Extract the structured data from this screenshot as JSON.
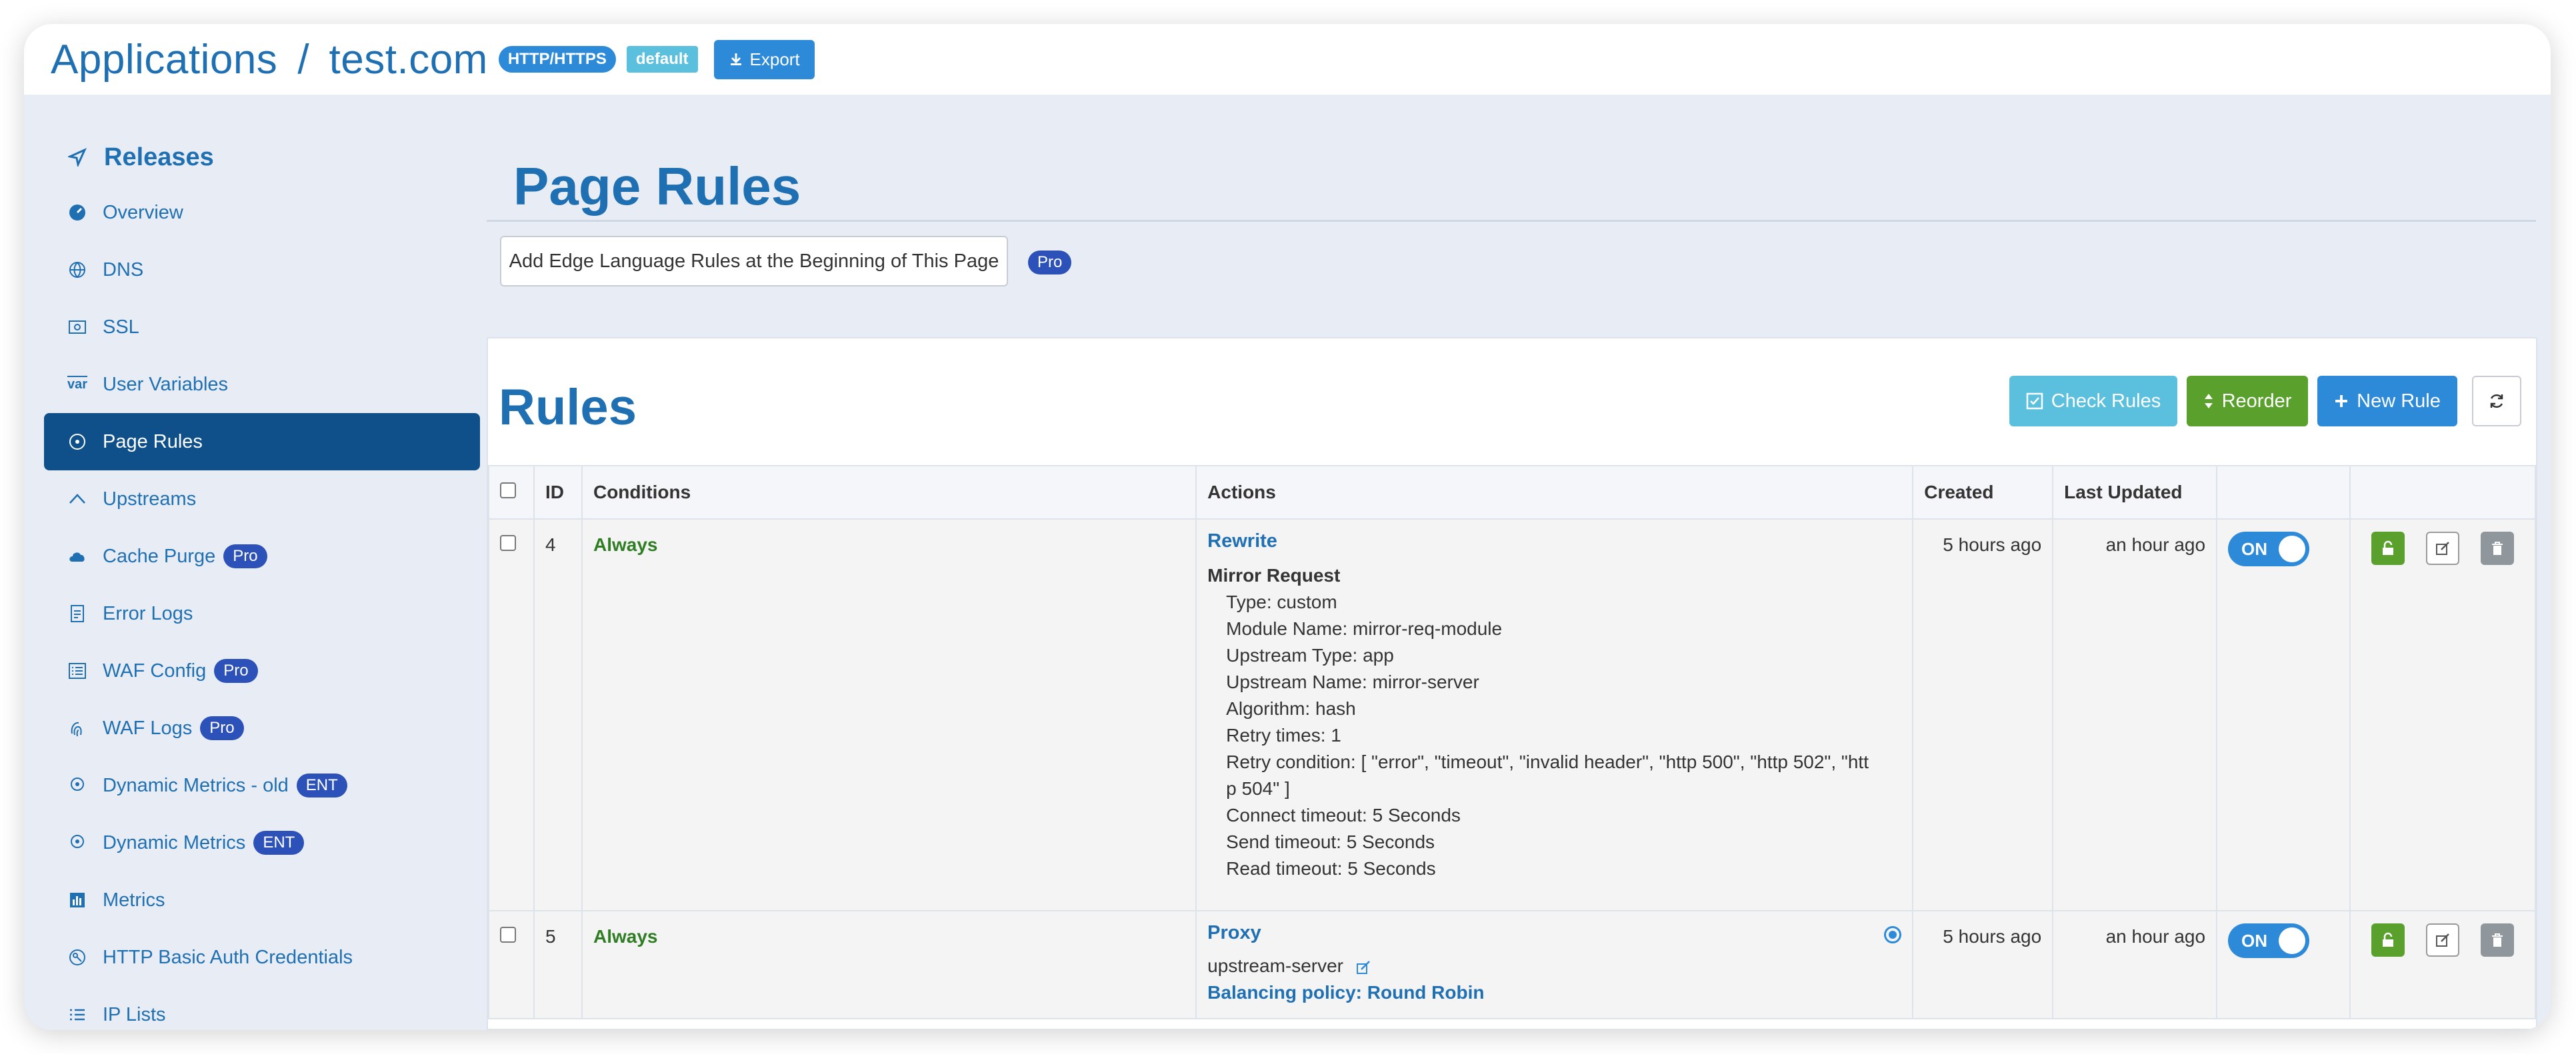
{
  "header": {
    "breadcrumb_root": "Applications",
    "separator": "/",
    "app_name": "test.com",
    "protocol_badge": "HTTP/HTTPS",
    "partition_badge": "default",
    "export_label": "Export"
  },
  "sidebar": {
    "heading": "Releases",
    "items": [
      {
        "label": "Overview",
        "icon": "dashboard-icon"
      },
      {
        "label": "DNS",
        "icon": "globe-icon"
      },
      {
        "label": "SSL",
        "icon": "certificate-icon"
      },
      {
        "label": "User Variables",
        "icon": "var-icon"
      },
      {
        "label": "Page Rules",
        "icon": "circle-icon"
      },
      {
        "label": "Upstreams",
        "icon": "chevron-up-icon"
      },
      {
        "label": "Cache Purge",
        "icon": "cloud-icon",
        "badge": "Pro"
      },
      {
        "label": "Error Logs",
        "icon": "log-icon"
      },
      {
        "label": "WAF Config",
        "icon": "list-icon",
        "badge": "Pro"
      },
      {
        "label": "WAF Logs",
        "icon": "fingerprint-icon",
        "badge": "Pro"
      },
      {
        "label": "Dynamic Metrics - old",
        "icon": "pin-icon",
        "badge": "ENT"
      },
      {
        "label": "Dynamic Metrics",
        "icon": "pin-icon",
        "badge": "ENT"
      },
      {
        "label": "Metrics",
        "icon": "bar-chart-icon"
      },
      {
        "label": "HTTP Basic Auth Credentials",
        "icon": "key-icon"
      },
      {
        "label": "IP Lists",
        "icon": "list-icon"
      }
    ]
  },
  "main": {
    "page_title": "Page Rules",
    "edge_button": "Add Edge Language Rules at the Beginning of This Page",
    "edge_badge": "Pro",
    "rules_title": "Rules",
    "toolbar": {
      "check_rules": "Check Rules",
      "reorder": "Reorder",
      "new_rule": "New Rule"
    },
    "columns": [
      "ID",
      "Conditions",
      "Actions",
      "Created",
      "Last Updated"
    ],
    "rows": [
      {
        "id": "4",
        "condition": "Always",
        "action_title": "Rewrite",
        "action_sub": "Mirror Request",
        "details": [
          "Type: custom",
          "Module Name: mirror-req-module",
          "Upstream Type: app",
          "Upstream Name: mirror-server",
          "Algorithm: hash",
          "Retry times: 1",
          "Retry condition: [ \"error\", \"timeout\", \"invalid header\", \"http 500\", \"http 502\", \"htt",
          "p 504\" ]",
          "Connect timeout: 5 Seconds",
          "Send timeout: 5 Seconds",
          "Read timeout: 5 Seconds"
        ],
        "created": "5 hours ago",
        "updated": "an hour ago",
        "toggle": "ON"
      },
      {
        "id": "5",
        "condition": "Always",
        "action_title": "Proxy",
        "upstream": "upstream-server",
        "policy": "Balancing policy: Round Robin",
        "created": "5 hours ago",
        "updated": "an hour ago",
        "toggle": "ON"
      }
    ]
  },
  "colors": {
    "brand_blue": "#1f6fb3",
    "active_nav": "#0f4f8a",
    "primary": "#2d8ad8",
    "info": "#5bc0de",
    "success": "#5aa02c",
    "badge_indigo": "#2c51b8"
  }
}
